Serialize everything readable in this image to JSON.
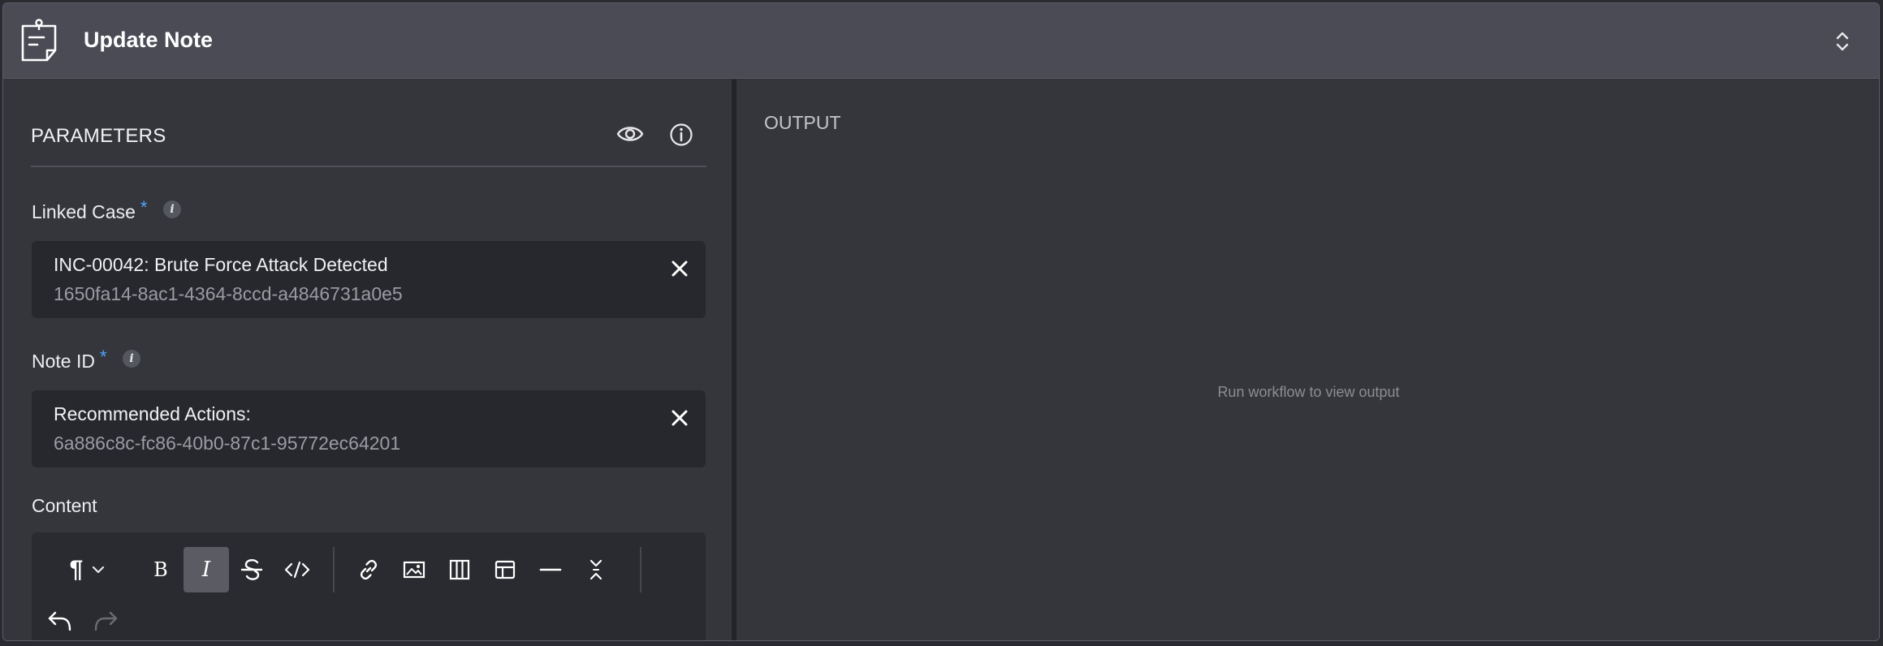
{
  "header": {
    "title": "Update Note",
    "icon": "sticky-note-icon"
  },
  "parameters": {
    "title": "PARAMETERS",
    "fields": {
      "linked_case": {
        "label": "Linked Case",
        "required_mark": "*",
        "value_title": "INC-00042: Brute Force Attack Detected",
        "value_id": "1650fa14-8ac1-4364-8ccd-a4846731a0e5"
      },
      "note_id": {
        "label": "Note ID",
        "required_mark": "*",
        "value_title": "Recommended Actions:",
        "value_id": "6a886c8c-fc86-40b0-87c1-95772ec64201"
      },
      "content": {
        "label": "Content"
      }
    },
    "info_glyph": "i"
  },
  "toolbar": {
    "paragraph_glyph": "¶",
    "bold_glyph": "B",
    "italic_glyph": "I",
    "italic_active": true
  },
  "output": {
    "title": "OUTPUT",
    "empty_text": "Run workflow to view output"
  },
  "colors": {
    "header_bg": "#4a4b55",
    "panel_bg": "#35363c",
    "input_bg": "#27282d",
    "required": "#4ea3ff",
    "active_button": "#5b5c63"
  }
}
